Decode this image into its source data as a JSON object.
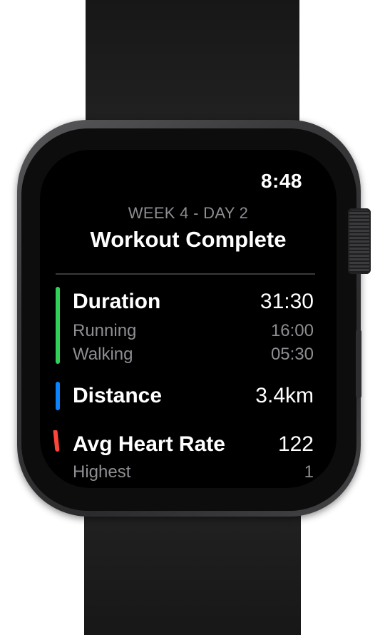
{
  "status_bar": {
    "time": "8:48"
  },
  "header": {
    "subtitle": "WEEK 4 - DAY 2",
    "title": "Workout Complete"
  },
  "stats": {
    "duration": {
      "label": "Duration",
      "value": "31:30",
      "color": "#30d158",
      "breakdown": [
        {
          "label": "Running",
          "value": "16:00"
        },
        {
          "label": "Walking",
          "value": "05:30"
        }
      ]
    },
    "distance": {
      "label": "Distance",
      "value": "3.4km",
      "color": "#0a84ff"
    },
    "heart_rate": {
      "label": "Avg Heart Rate",
      "value": "122",
      "color": "#ff453a",
      "breakdown": [
        {
          "label": "Highest",
          "value": "1"
        }
      ]
    }
  },
  "colors": {
    "screen_background": "#000000",
    "secondary_text": "#8e8e93",
    "band": "#1c1c1e",
    "case": "#3a3a3c"
  }
}
